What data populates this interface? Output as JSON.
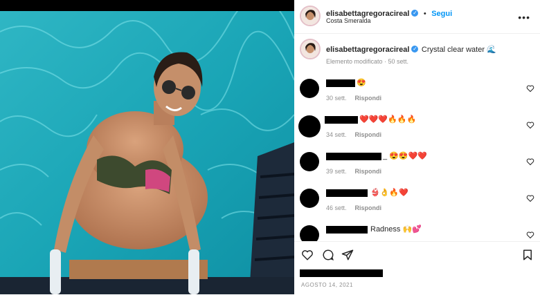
{
  "post": {
    "username": "elisabettagregoracireal",
    "follow_label": "Segui",
    "location": "Costa Smeralda",
    "more_label": "•••",
    "caption": "Crystal clear water 🌊",
    "caption_meta": "Elemento modificato · 50 sett.",
    "date": "AGOSTO 14, 2021"
  },
  "comments": [
    {
      "text": "😍",
      "time": "30 sett.",
      "reply": "Rispondi"
    },
    {
      "text": "❤️❤️❤️🔥🔥🔥",
      "time": "34 sett.",
      "reply": "Rispondi"
    },
    {
      "text": "_ 😍😍❤️❤️",
      "time": "39 sett.",
      "reply": "Rispondi"
    },
    {
      "text": "👙👌🔥❤️",
      "time": "46 sett.",
      "reply": "Rispondi"
    },
    {
      "text": "Radness 🙌💕",
      "time": "",
      "reply": ""
    }
  ],
  "icons": {
    "like": "heart-icon",
    "comment": "comment-icon",
    "share": "send-icon",
    "save": "bookmark-icon",
    "verified": "verified-badge-icon"
  },
  "colors": {
    "accent": "#0095f6",
    "verified": "#3897f0",
    "water": "#1fb3c0"
  }
}
